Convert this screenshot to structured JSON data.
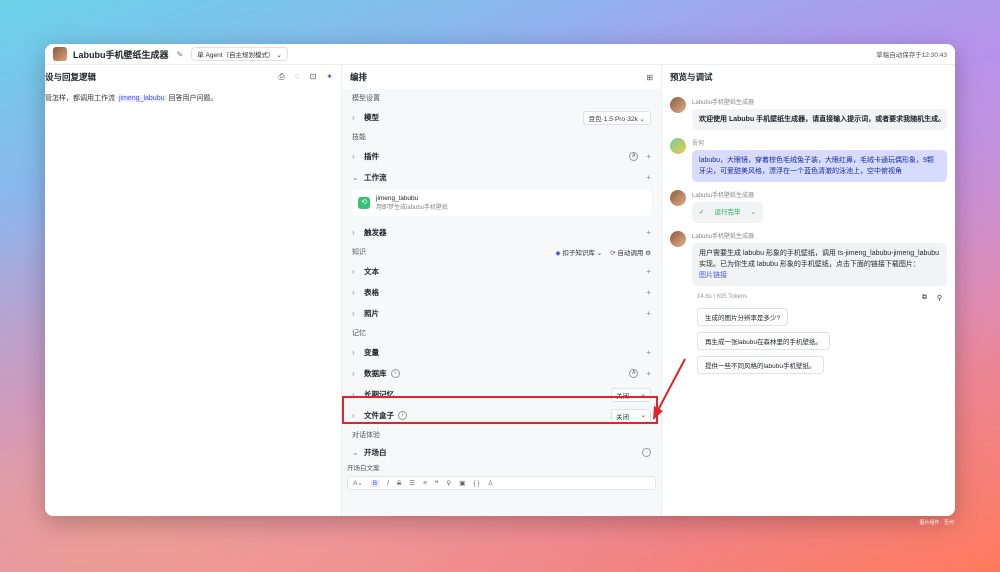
{
  "topbar": {
    "app_title": "Labubu手机壁纸生成器",
    "mode": "单 Agent（自主规划模式）",
    "autosave": "草稿自动保存于12:30:43"
  },
  "left": {
    "title": "设与回复逻辑",
    "body_prefix": "管怎样，都调用工作流 ",
    "body_tag": "jimeng_labubu",
    "body_suffix": " 回答用户问题。"
  },
  "middle": {
    "title": "编排",
    "model_section": "模型设置",
    "model_label": "模型",
    "model_value": "豆包·1.5·Pro·32k",
    "skills_section": "技能",
    "plugin_label": "插件",
    "workflow_label": "工作流",
    "workflow_name": "jimeng_labubu",
    "workflow_desc": "用即梦生成labubu手机壁纸",
    "trigger_label": "触发器",
    "knowledge_section": "知识",
    "kb_source": "扣子知识库",
    "kb_call": "自动调用",
    "text_label": "文本",
    "table_label": "表格",
    "photo_label": "照片",
    "memory_section": "记忆",
    "variable_label": "变量",
    "database_label": "数据库",
    "longterm_label": "长期记忆",
    "longterm_value": "关闭",
    "filebox_label": "文件盒子",
    "filebox_value": "关闭",
    "dialog_section": "对话体验",
    "opening_label": "开场白",
    "opening_text_label": "开场白文案"
  },
  "right": {
    "title": "预览与调试",
    "bot_name": "Labubu手机壁纸生成器",
    "user_name": "吾何",
    "welcome": "欢迎使用 Labubu 手机壁纸生成器，请直接输入提示词，或者要求我随机生成。",
    "user_msg": "labubu，大眼镜，穿着棕色毛绒兔子装，大眼红鼻，毛绒卡通玩偶形象，9颗牙尖，可爱甜美风格，漂浮在一个蓝色清澈的泳池上，空中俯视角",
    "run_status": "运行完毕",
    "reply": "用户需要生成 labubu 形象的手机壁纸，调用 ts-jimeng_labubu-jimeng_labubu 实现。已为你生成 labubu 形象的手机壁纸，点击下面的链接下载图片：",
    "reply_link": "图片链接",
    "meta_time": "14.6s",
    "meta_sep": "|",
    "meta_tokens": "635 Tokens",
    "suggestions": [
      "生成的图片分辨率是多少?",
      "再生成一张labubu在森林里的手机壁纸。",
      "提供一些不同风格的labubu手机壁纸。"
    ]
  },
  "watermark": "图片组件 · 吾何",
  "colors": {
    "accent": "#4d53e8",
    "highlight": "#e0242b",
    "success": "#23a455"
  }
}
